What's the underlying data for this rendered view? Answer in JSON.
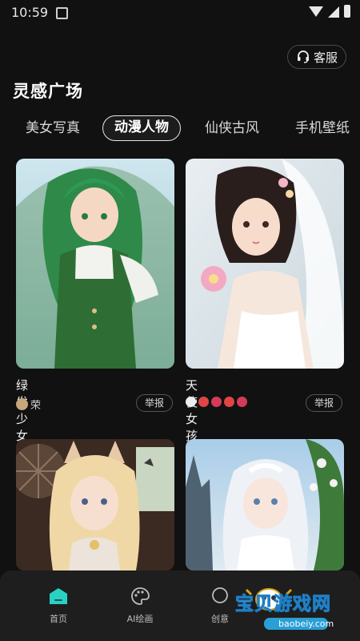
{
  "status": {
    "time": "10:59"
  },
  "header": {
    "service_label": "客服",
    "page_title": "灵感广场"
  },
  "tabs": [
    {
      "label": "美女写真",
      "active": false
    },
    {
      "label": "动漫人物",
      "active": true
    },
    {
      "label": "仙侠古风",
      "active": false
    },
    {
      "label": "手机壁纸",
      "active": false
    }
  ],
  "cards": [
    {
      "title": "绿发少女",
      "author": "荣",
      "report": "举报"
    },
    {
      "title": "天使女孩",
      "author": "",
      "report": "举报"
    },
    {
      "title": "",
      "author": "",
      "report": ""
    },
    {
      "title": "",
      "author": "",
      "report": ""
    }
  ],
  "nav": [
    {
      "label": "首页",
      "active": true
    },
    {
      "label": "AI绘画",
      "active": false
    },
    {
      "label": "创意",
      "active": false
    }
  ],
  "watermark": {
    "main": "宝贝游戏网",
    "url": "baobeiy.com"
  },
  "colors": {
    "accent": "#2ad1c2",
    "background": "#111111",
    "navbar": "#1e1e1e"
  }
}
